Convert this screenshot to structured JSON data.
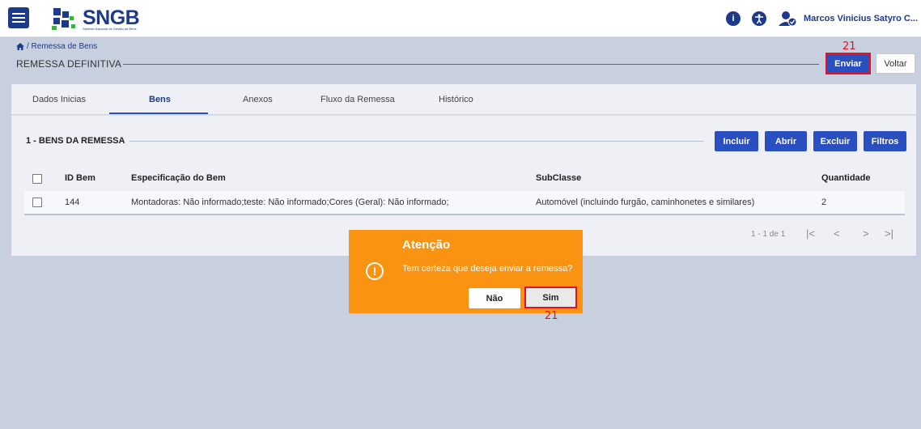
{
  "app": {
    "logo_title": "SNGB",
    "logo_subtitle": "Sistema Nacional de Gestão de Bens",
    "user_name": "Marcos Vinicius Satyro C..."
  },
  "breadcrumb": {
    "text": "/ Remessa de Bens"
  },
  "page": {
    "title": "REMESSA DEFINITIVA"
  },
  "actions": {
    "enviar": "Enviar",
    "voltar": "Voltar"
  },
  "annotations": {
    "enviar": "21",
    "sim": "21"
  },
  "tabs": [
    {
      "label": "Dados Inicias",
      "active": false
    },
    {
      "label": "Bens",
      "active": true
    },
    {
      "label": "Anexos",
      "active": false
    },
    {
      "label": "Fluxo da Remessa",
      "active": false
    },
    {
      "label": "Histórico",
      "active": false
    }
  ],
  "section": {
    "title": "1 - BENS DA REMESSA",
    "buttons": {
      "incluir": "Incluir",
      "abrir": "Abrir",
      "excluir": "Excluir",
      "filtros": "Filtros"
    }
  },
  "table": {
    "columns": [
      "ID Bem",
      "Especificação do Bem",
      "SubClasse",
      "Quantidade"
    ],
    "rows": [
      {
        "id": "144",
        "especificacao": "Montadoras: Não informado;teste: Não informado;Cores (Geral): Não informado;",
        "subclasse": "Automóvel (incluindo furgão, caminhonetes e similares)",
        "quantidade": "2"
      }
    ]
  },
  "pagination": {
    "range": "1 - 1 de 1",
    "first": "|<",
    "prev": "<",
    "next": ">",
    "last": ">|"
  },
  "dialog": {
    "title": "Atenção",
    "icon": "!",
    "message": "Tem certeza que deseja enviar a remessa?",
    "no_label": "Não",
    "yes_label": "Sim"
  },
  "colors": {
    "brand": "#1d3a8a",
    "primary_button": "#2a4fc0",
    "dialog": "#fa9312",
    "highlight": "#e8101a",
    "background": "#c8cfdf"
  }
}
